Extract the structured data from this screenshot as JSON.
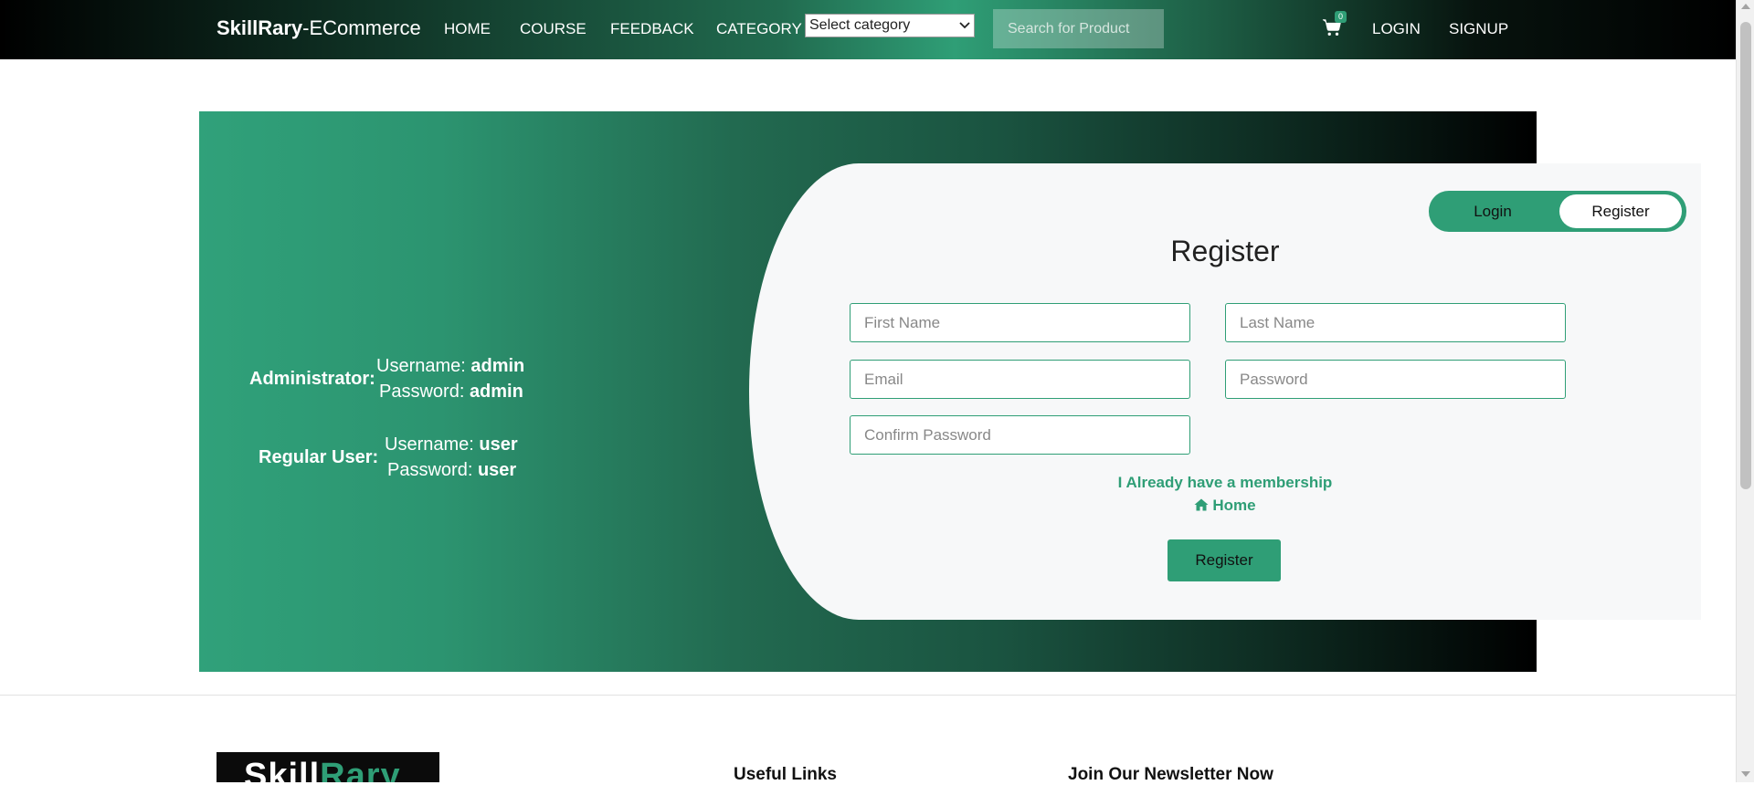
{
  "navbar": {
    "brand_bold": "SkillRary",
    "brand_rest": "-ECommerce",
    "links": [
      "HOME",
      "COURSE",
      "FEEDBACK",
      "CATEGORY"
    ],
    "category_select": "Select category",
    "search_placeholder": "Search for Product",
    "cart_count": "0",
    "login": "LOGIN",
    "signup": "SIGNUP"
  },
  "credentials": {
    "admin": {
      "role": "Administrator:",
      "username_label": "Username:",
      "username": "admin",
      "password_label": "Password:",
      "password": "admin"
    },
    "user": {
      "role": "Regular User:",
      "username_label": "Username:",
      "username": "user",
      "password_label": "Password:",
      "password": "user"
    }
  },
  "form": {
    "toggle_login": "Login",
    "toggle_register": "Register",
    "title": "Register",
    "first_name_placeholder": "First Name",
    "last_name_placeholder": "Last Name",
    "email_placeholder": "Email",
    "password_placeholder": "Password",
    "confirm_password_placeholder": "Confirm Password",
    "membership_link": "I Already have a membership",
    "home_link": "Home",
    "register_button": "Register"
  },
  "footer": {
    "logo_white": "Skill",
    "logo_green": "Rary",
    "useful_links": "Useful Links",
    "newsletter": "Join Our Newsletter Now"
  },
  "colors": {
    "accent": "#2f9e76",
    "navbar_dark": "#000000"
  }
}
